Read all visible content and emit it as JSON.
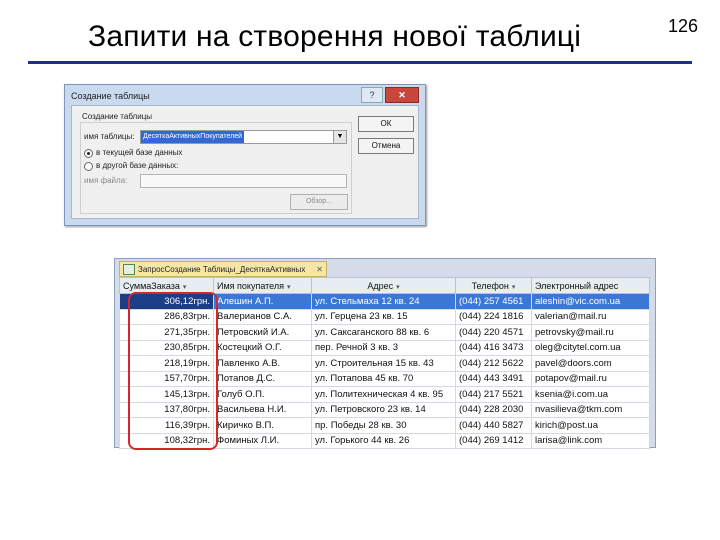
{
  "slide": {
    "title": "Запити на створення нової таблиці",
    "page_number": "126"
  },
  "dialog": {
    "caption": "Создание таблицы",
    "controls": [
      "?",
      "✕"
    ],
    "group_label": "Создание таблицы",
    "table_name_label": "имя таблицы:",
    "table_name_value": "ДесяткаАктивныхПокупателей",
    "radio_current": "в текущей базе данных",
    "radio_other": "в другой базе данных:",
    "file_label": "имя файла:",
    "browse_label": "Обзор...",
    "ok_label": "ОК",
    "cancel_label": "Отмена"
  },
  "query": {
    "tab_title": "ЗапросСоздание Таблицы_ДесяткаАктивных",
    "columns": [
      "СуммаЗаказа",
      "Имя покупателя",
      "Адрес",
      "Телефон",
      "Электронный адрес"
    ],
    "rows": [
      {
        "sum": "306,12грн.",
        "name": "Алешин А.П.",
        "address": "ул. Стельмаха 12 кв. 24",
        "phone": "(044) 257 4561",
        "email": "aleshin@vic.com.ua"
      },
      {
        "sum": "286,83грн.",
        "name": "Валерианов С.А.",
        "address": "ул. Герцена 23 кв. 15",
        "phone": "(044) 224 1816",
        "email": "valerian@mail.ru"
      },
      {
        "sum": "271,35грн.",
        "name": "Петровский И.А.",
        "address": "ул. Саксаганского 88 кв. 6",
        "phone": "(044) 220 4571",
        "email": "petrovsky@mail.ru"
      },
      {
        "sum": "230,85грн.",
        "name": "Костецкий О.Г.",
        "address": "пер. Речной 3 кв. 3",
        "phone": "(044) 416 3473",
        "email": "oleg@citytel.com.ua"
      },
      {
        "sum": "218,19грн.",
        "name": "Павленко А.В.",
        "address": "ул. Строительная 15 кв. 43",
        "phone": "(044) 212 5622",
        "email": "pavel@doors.com"
      },
      {
        "sum": "157,70грн.",
        "name": "Потапов Д.С.",
        "address": "ул. Потапова 45 кв. 70",
        "phone": "(044) 443 3491",
        "email": "potapov@mail.ru"
      },
      {
        "sum": "145,13грн.",
        "name": "Голуб О.П.",
        "address": "ул. Политехническая 4 кв. 95",
        "phone": "(044) 217 5521",
        "email": "ksenia@i.com.ua"
      },
      {
        "sum": "137,80грн.",
        "name": "Васильева Н.И.",
        "address": "ул. Петровского 23 кв. 14",
        "phone": "(044) 228 2030",
        "email": "nvasilieva@tkm.com"
      },
      {
        "sum": "116,39грн.",
        "name": "Киричко В.П.",
        "address": "пр. Победы 28 кв. 30",
        "phone": "(044) 440 5827",
        "email": "kirich@post.ua"
      },
      {
        "sum": "108,32грн.",
        "name": "Фоминых Л.И.",
        "address": "ул. Горького 44 кв. 26",
        "phone": "(044) 269 1412",
        "email": "larisa@link.com"
      }
    ]
  },
  "colors": {
    "title_rule": "#1f2f8f",
    "highlight": "#d42828",
    "selected_row": "#3b78d6"
  }
}
